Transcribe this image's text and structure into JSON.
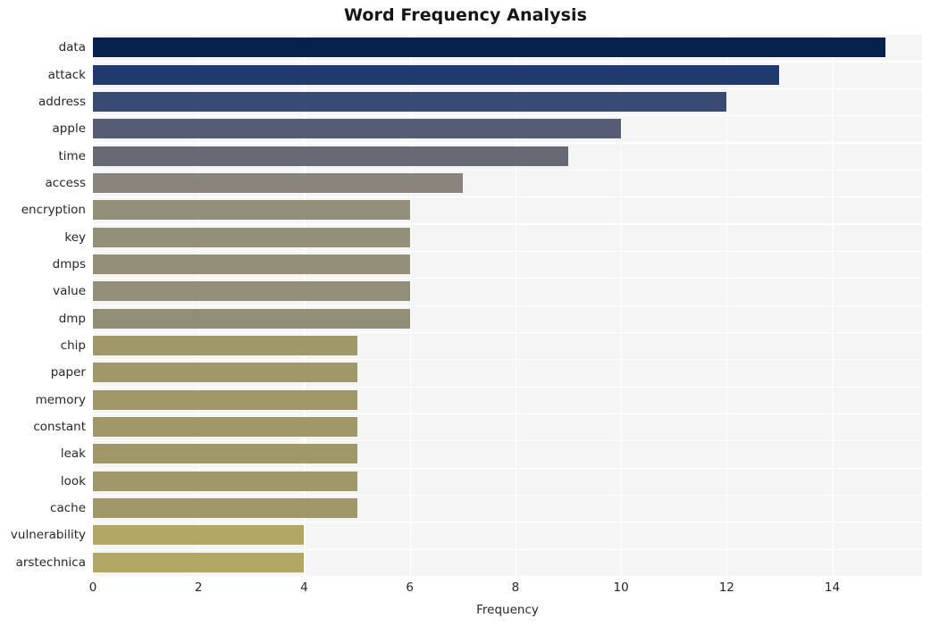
{
  "chart_data": {
    "type": "bar",
    "orientation": "horizontal",
    "title": "Word Frequency Analysis",
    "xlabel": "Frequency",
    "ylabel": "",
    "categories": [
      "data",
      "attack",
      "address",
      "apple",
      "time",
      "access",
      "encryption",
      "key",
      "dmps",
      "value",
      "dmp",
      "chip",
      "paper",
      "memory",
      "constant",
      "leak",
      "look",
      "cache",
      "vulnerability",
      "arstechnica"
    ],
    "values": [
      15,
      13,
      12,
      10,
      9,
      7,
      6,
      6,
      6,
      6,
      6,
      5,
      5,
      5,
      5,
      5,
      5,
      5,
      4,
      4
    ],
    "bar_colors": [
      "#04224c",
      "#1f3a6e",
      "#394b73",
      "#565c73",
      "#666a75",
      "#89857e",
      "#938f78",
      "#938f78",
      "#938f78",
      "#928e77",
      "#918e76",
      "#a09868",
      "#a09868",
      "#a09868",
      "#a09868",
      "#a09868",
      "#a09868",
      "#a09868",
      "#b2a765",
      "#b2a765"
    ],
    "xticks": [
      0,
      2,
      4,
      6,
      8,
      10,
      12,
      14
    ],
    "xlim": [
      0,
      15.7
    ],
    "grid": true,
    "grid_color": "#ffffff",
    "plot_background": "#f5f5f5",
    "figure_background": "#ffffff",
    "legend": null
  }
}
